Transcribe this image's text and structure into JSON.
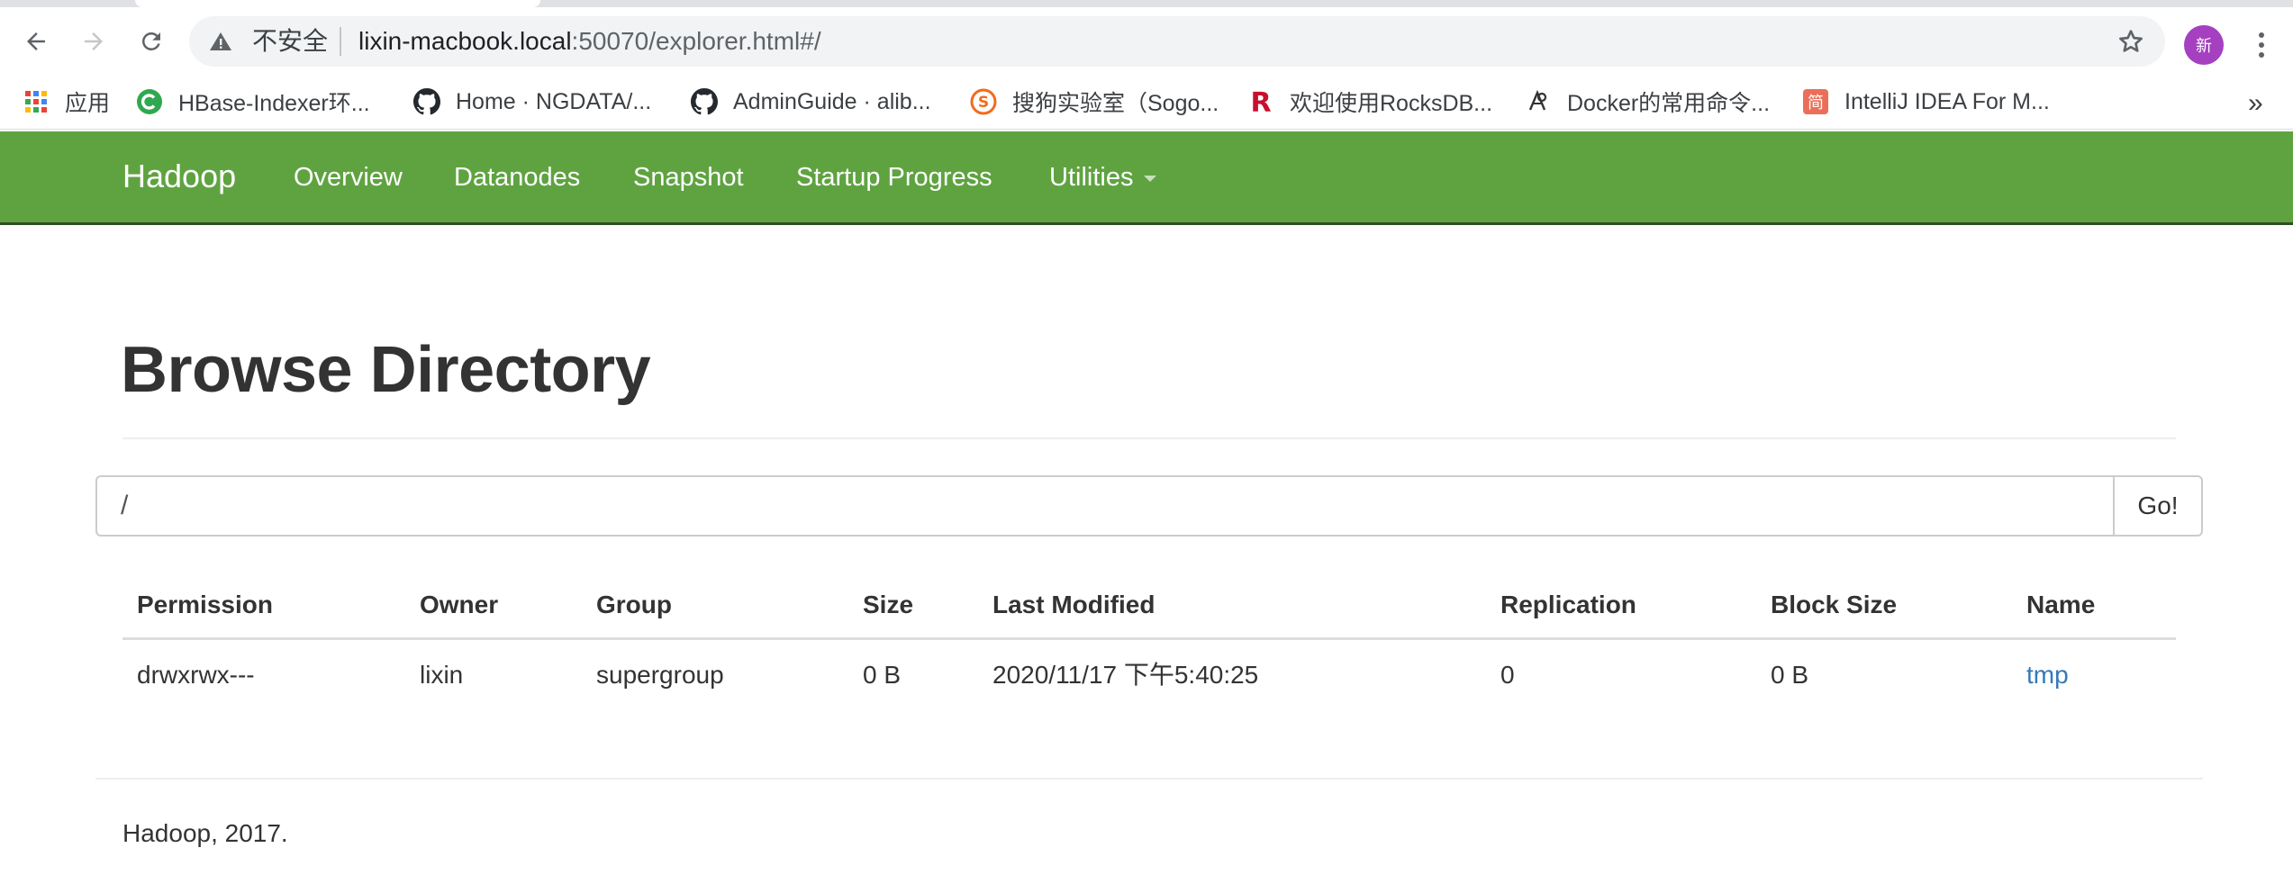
{
  "browser": {
    "address": {
      "security_label": "不安全",
      "url_host": "lixin-macbook.local",
      "url_rest": ":50070/explorer.html#/"
    },
    "profile_initial": "新",
    "more_bookmarks": "»"
  },
  "bookmarks": [
    {
      "label": "应用",
      "icon": "apps-grid-icon"
    },
    {
      "label": "HBase-Indexer环...",
      "icon": "site-c-icon"
    },
    {
      "label": "Home · NGDATA/...",
      "icon": "github-icon"
    },
    {
      "label": "AdminGuide · alib...",
      "icon": "github-icon"
    },
    {
      "label": "搜狗实验室（Sogo...",
      "icon": "sogou-icon"
    },
    {
      "label": "欢迎使用RocksDB...",
      "icon": "rocksdb-icon"
    },
    {
      "label": "Docker的常用命令...",
      "icon": "docker-site-icon"
    },
    {
      "label": "IntelliJ IDEA For M...",
      "icon": "jianshu-icon"
    }
  ],
  "navbar": {
    "brand": "Hadoop",
    "items": [
      "Overview",
      "Datanodes",
      "Snapshot",
      "Startup Progress",
      "Utilities"
    ],
    "color": "#5fa341"
  },
  "page": {
    "title": "Browse Directory",
    "path_value": "/",
    "go_label": "Go!"
  },
  "table": {
    "headers": [
      "Permission",
      "Owner",
      "Group",
      "Size",
      "Last Modified",
      "Replication",
      "Block Size",
      "Name"
    ],
    "rows": [
      [
        "drwxrwx---",
        "lixin",
        "supergroup",
        "0 B",
        "2020/11/17 下午5:40:25",
        "0",
        "0 B",
        "tmp"
      ]
    ],
    "link_color": "#337ab7"
  },
  "footer": {
    "text": "Hadoop, 2017."
  }
}
